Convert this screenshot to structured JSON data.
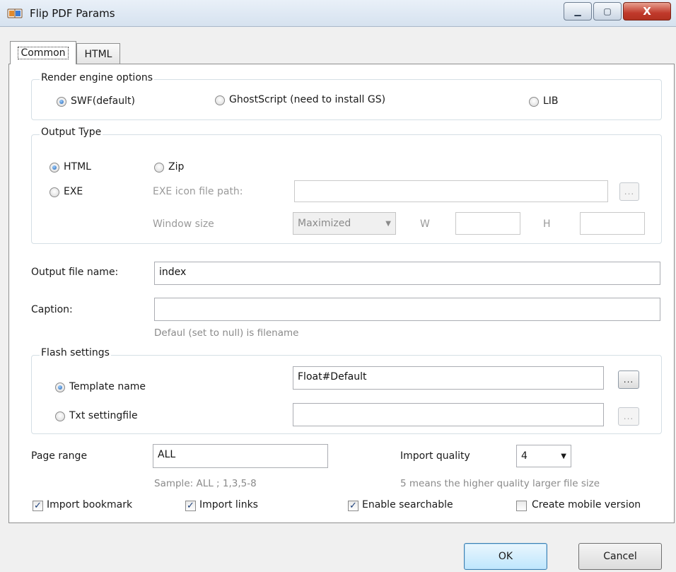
{
  "window": {
    "title": "Flip PDF Params",
    "minimize_glyph": "▁",
    "maximize_glyph": "▢",
    "close_glyph": "X"
  },
  "tabs": [
    {
      "label": "Common",
      "active": true
    },
    {
      "label": "HTML",
      "active": false
    }
  ],
  "render_engine": {
    "group_label": "Render engine options",
    "options": [
      {
        "label": "SWF(default)",
        "selected": true
      },
      {
        "label": "GhostScript (need to install GS)",
        "selected": false
      },
      {
        "label": "LIB",
        "selected": false
      }
    ]
  },
  "output_type": {
    "group_label": "Output Type",
    "html_label": "HTML",
    "zip_label": "Zip",
    "exe_label": "EXE",
    "selected": "HTML",
    "exe_icon_label": "EXE icon file path:",
    "exe_icon_value": "",
    "browse_glyph": "...",
    "window_size_label": "Window size",
    "window_size_value": "Maximized",
    "w_label": "W",
    "h_label": "H",
    "w_value": "",
    "h_value": ""
  },
  "output_file": {
    "label": "Output file name:",
    "value": "index"
  },
  "caption": {
    "label": "Caption:",
    "value": "",
    "hint": "Defaul (set to null) is filename"
  },
  "flash_settings": {
    "group_label": "Flash settings",
    "template_label": "Template name",
    "template_value": "Float#Default",
    "txt_label": "Txt settingfile",
    "txt_value": "",
    "selected": "Template name",
    "browse_glyph": "..."
  },
  "page_range": {
    "label": "Page range",
    "value": "ALL",
    "hint": "Sample: ALL ; 1,3,5-8"
  },
  "import_quality": {
    "label": "Import quality",
    "value": "4",
    "hint": "5 means the higher quality larger file size"
  },
  "checkboxes": {
    "bookmark": {
      "label": "Import bookmark",
      "checked": true
    },
    "links": {
      "label": "Import links",
      "checked": true
    },
    "searchable": {
      "label": "Enable searchable",
      "checked": true
    },
    "mobile": {
      "label": "Create mobile version",
      "checked": false
    }
  },
  "check_glyph": "✓",
  "buttons": {
    "ok": "OK",
    "cancel": "Cancel"
  },
  "colors": {
    "accent": "#3c7fb1",
    "close_red": "#c0392b",
    "disabled_text": "#9a9a9a"
  }
}
